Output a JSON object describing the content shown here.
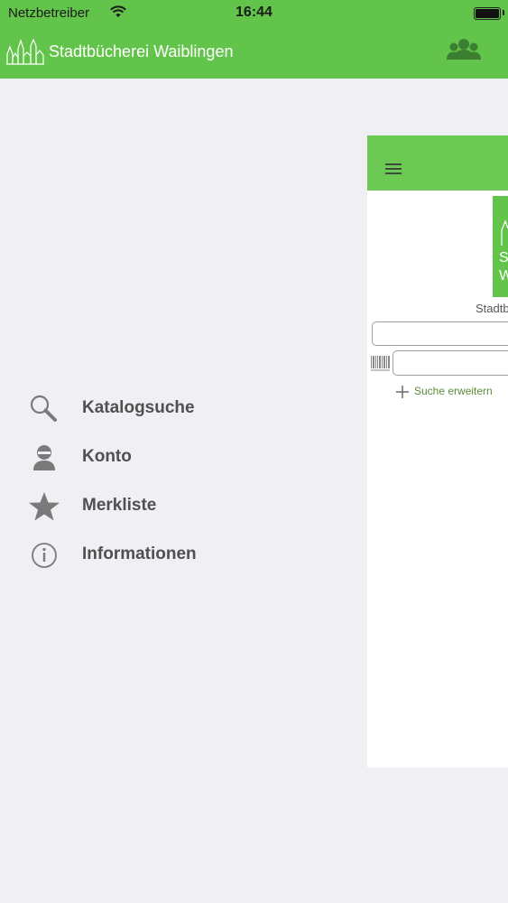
{
  "status_bar": {
    "carrier": "Netzbetreiber",
    "time": "16:44"
  },
  "header": {
    "app_title": "Stadtbücherei Waiblingen",
    "logo_icon": "city-skyline-icon",
    "account_icon": "users-icon",
    "color": "#62c44a"
  },
  "menu": {
    "items": [
      {
        "label": "Katalogsuche",
        "icon": "search-icon"
      },
      {
        "label": "Konto",
        "icon": "user-icon"
      },
      {
        "label": "Merkliste",
        "icon": "star-icon"
      },
      {
        "label": "Informationen",
        "icon": "info-icon"
      }
    ]
  },
  "preview": {
    "menu_icon": "hamburger-icon",
    "brand_letters": [
      "S",
      "W"
    ],
    "brand_name": "Stadtb",
    "barcode_icon": "barcode-icon",
    "extend_search_label": "Suche erweitern",
    "header_color": "#6bc954"
  }
}
